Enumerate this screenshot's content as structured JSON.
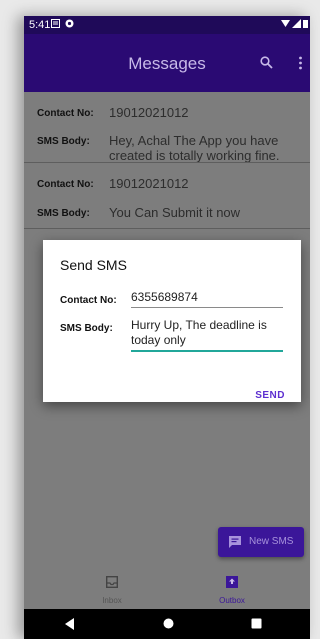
{
  "status_bar": {
    "time": "5:41"
  },
  "app_bar": {
    "title": "Messages",
    "search_icon": "search-icon",
    "overflow_icon": "more-vert-icon"
  },
  "messages": [
    {
      "contact_label": "Contact No:",
      "contact": "19012021012",
      "body_label": "SMS Body:",
      "body": "Hey, Achal The App you have created is totally working fine."
    },
    {
      "contact_label": "Contact No:",
      "contact": "19012021012",
      "body_label": "SMS Body:",
      "body": "You Can Submit it now"
    }
  ],
  "dialog": {
    "title": "Send SMS",
    "contact_label": "Contact No:",
    "contact_value": "6355689874",
    "body_label": "SMS Body:",
    "body_value": "Hurry Up, The deadline is today only",
    "send_label": "SEND"
  },
  "fab": {
    "label": "New SMS",
    "icon": "message-icon"
  },
  "bottom_nav": [
    {
      "label": "Inbox",
      "icon": "inbox-icon",
      "active": false
    },
    {
      "label": "Outbox",
      "icon": "outbox-icon",
      "active": true
    }
  ],
  "colors": {
    "primary_dark": "#1f0a59",
    "primary": "#2a0a73",
    "accent": "#5d2fd0",
    "input_focus": "#21a79a",
    "scrim_bg": "#7d7d7d",
    "nav_active": "#3b1699"
  }
}
